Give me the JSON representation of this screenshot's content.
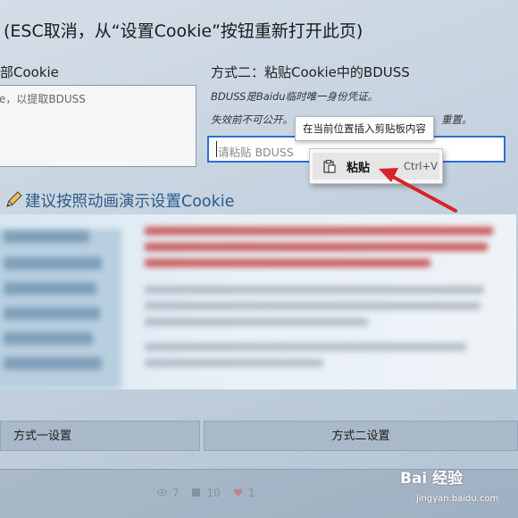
{
  "dialog": {
    "title": "(ESC取消，从“设置Cookie”按钮重新打开此页)"
  },
  "method_one": {
    "heading": "部Cookie",
    "box_text": "e，以提取BDUSS",
    "button_label": "方式一设置"
  },
  "method_two": {
    "heading": "方式二：粘贴Cookie中的BDUSS",
    "note_line1": "BDUSS是Baidu临时唯一身份凭证。",
    "note_line2": "失效前不可公开。",
    "note_line2_tail": "重置。",
    "input_placeholder": "请粘贴 BDUSS",
    "button_label": "方式二设置"
  },
  "tooltip": {
    "text": "在当前位置插入剪贴板内容"
  },
  "context_menu": {
    "item_label": "粘贴",
    "item_shortcut": "Ctrl+V",
    "item_icon": "clipboard-icon"
  },
  "demo": {
    "heading": "建议按照动画演示设置Cookie",
    "heading_icon": "pencil-icon"
  },
  "footer": {
    "views": "7",
    "favorites": "10",
    "likes": "1"
  },
  "watermark": {
    "logo_text": "Bai 经验",
    "url": "jingyan.baidu.com"
  },
  "colors": {
    "accent": "#2c6fd1",
    "arrow": "#d9232a",
    "demo_heading": "#2b5a8a"
  }
}
